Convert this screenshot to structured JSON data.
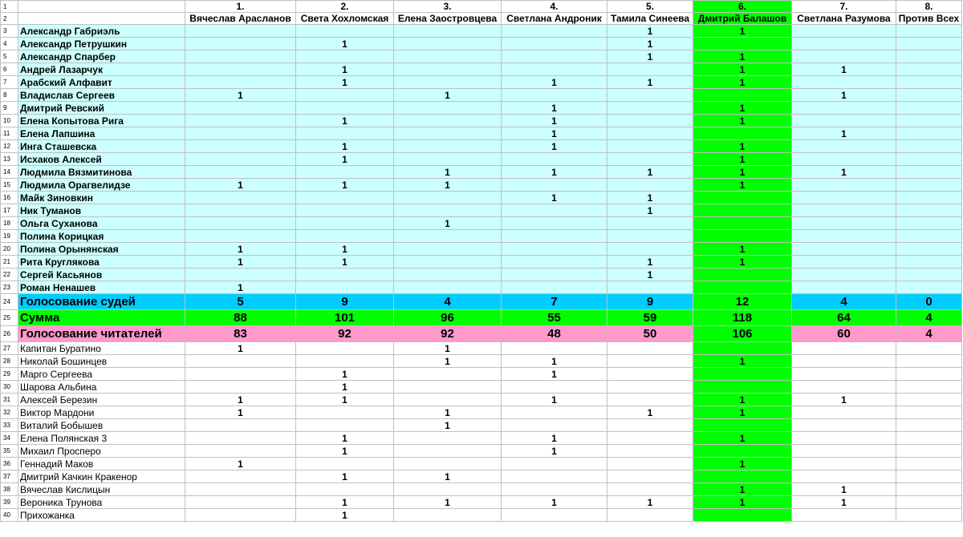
{
  "sheet": {
    "accent_colors": {
      "judge_rows": "#ccffff",
      "highlight_column": "#00ff00",
      "judges_total_row": "#00ccff",
      "sum_row": "#00ff00",
      "readers_total_row": "#ff99cc"
    },
    "header_numbers": [
      "1.",
      "2.",
      "3.",
      "4.",
      "5.",
      "6.",
      "7.",
      "8."
    ],
    "candidates": [
      "Вячеслав Арасланов",
      "Света Хохломская",
      "Елена Заостровцева",
      "Светлана Андроник",
      "Тамила Синеева",
      "Дмитрий Балашов",
      "Светлана Разумова",
      "Против Всех"
    ],
    "judges": [
      {
        "row": "3",
        "name": "Александр Габриэль",
        "votes": [
          "",
          "",
          "",
          "",
          "1",
          "1",
          "",
          ""
        ]
      },
      {
        "row": "4",
        "name": "Александр Петрушкин",
        "votes": [
          "",
          "1",
          "",
          "",
          "1",
          "",
          "",
          ""
        ]
      },
      {
        "row": "5",
        "name": "Александр Спарбер",
        "votes": [
          "",
          "",
          "",
          "",
          "1",
          "1",
          "",
          ""
        ]
      },
      {
        "row": "6",
        "name": "Андрей Лазарчук",
        "votes": [
          "",
          "1",
          "",
          "",
          "",
          "1",
          "1",
          ""
        ]
      },
      {
        "row": "7",
        "name": "Арабский Алфавит",
        "votes": [
          "",
          "1",
          "",
          "1",
          "1",
          "1",
          "",
          ""
        ]
      },
      {
        "row": "8",
        "name": "Владислав Сергеев",
        "votes": [
          "1",
          "",
          "1",
          "",
          "",
          "",
          "1",
          ""
        ]
      },
      {
        "row": "9",
        "name": "Дмитрий Ревский",
        "votes": [
          "",
          "",
          "",
          "1",
          "",
          "1",
          "",
          ""
        ]
      },
      {
        "row": "10",
        "name": "Елена Копытова Рига",
        "votes": [
          "",
          "1",
          "",
          "1",
          "",
          "1",
          "",
          ""
        ]
      },
      {
        "row": "11",
        "name": "Елена Лапшина",
        "votes": [
          "",
          "",
          "",
          "1",
          "",
          "",
          "1",
          ""
        ]
      },
      {
        "row": "12",
        "name": "Инга Сташевска",
        "votes": [
          "",
          "1",
          "",
          "1",
          "",
          "1",
          "",
          ""
        ]
      },
      {
        "row": "13",
        "name": "Исхаков Алексей",
        "votes": [
          "",
          "1",
          "",
          "",
          "",
          "1",
          "",
          ""
        ]
      },
      {
        "row": "14",
        "name": "Людмила Вязмитинова",
        "votes": [
          "",
          "",
          "1",
          "1",
          "1",
          "1",
          "1",
          ""
        ]
      },
      {
        "row": "15",
        "name": "Людмила Орагвелидзе",
        "votes": [
          "1",
          "1",
          "1",
          "",
          "",
          "1",
          "",
          ""
        ]
      },
      {
        "row": "16",
        "name": "Майк Зиновкин",
        "votes": [
          "",
          "",
          "",
          "1",
          "1",
          "",
          "",
          ""
        ]
      },
      {
        "row": "17",
        "name": "Ник Туманов",
        "votes": [
          "",
          "",
          "",
          "",
          "1",
          "",
          "",
          ""
        ]
      },
      {
        "row": "18",
        "name": "Ольга Суханова",
        "votes": [
          "",
          "",
          "1",
          "",
          "",
          "",
          "",
          ""
        ]
      },
      {
        "row": "19",
        "name": "Полина Корицкая",
        "votes": [
          "",
          "",
          "",
          "",
          "",
          "",
          "",
          ""
        ]
      },
      {
        "row": "20",
        "name": "Полина Орынянская",
        "votes": [
          "1",
          "1",
          "",
          "",
          "",
          "1",
          "",
          ""
        ]
      },
      {
        "row": "21",
        "name": "Рита Круглякова",
        "votes": [
          "1",
          "1",
          "",
          "",
          "1",
          "1",
          "",
          ""
        ]
      },
      {
        "row": "22",
        "name": "Сергей Касьянов",
        "votes": [
          "",
          "",
          "",
          "",
          "1",
          "",
          "",
          ""
        ]
      },
      {
        "row": "23",
        "name": "Роман Ненашев",
        "votes": [
          "1",
          "",
          "",
          "",
          "",
          "",
          "",
          ""
        ]
      }
    ],
    "totals": [
      {
        "row": "24",
        "label": "Голосование судей",
        "values": [
          "5",
          "9",
          "4",
          "7",
          "9",
          "12",
          "4",
          "0"
        ]
      },
      {
        "row": "25",
        "label": "Сумма",
        "values": [
          "88",
          "101",
          "96",
          "55",
          "59",
          "118",
          "64",
          "4"
        ]
      },
      {
        "row": "26",
        "label": "Голосование читателей",
        "values": [
          "83",
          "92",
          "92",
          "48",
          "50",
          "106",
          "60",
          "4"
        ]
      }
    ],
    "readers": [
      {
        "row": "27",
        "name": "Капитан Буратино",
        "votes": [
          "1",
          "",
          "1",
          "",
          "",
          "",
          "",
          ""
        ]
      },
      {
        "row": "28",
        "name": "Николай Бошинцев",
        "votes": [
          "",
          "",
          "1",
          "1",
          "",
          "1",
          "",
          ""
        ]
      },
      {
        "row": "29",
        "name": "Марго Сергеева",
        "votes": [
          "",
          "1",
          "",
          "1",
          "",
          "",
          "",
          ""
        ]
      },
      {
        "row": "30",
        "name": "Шарова Альбина",
        "votes": [
          "",
          "1",
          "",
          "",
          "",
          "",
          "",
          ""
        ]
      },
      {
        "row": "31",
        "name": "Алексей Березин",
        "votes": [
          "1",
          "1",
          "",
          "1",
          "",
          "1",
          "1",
          ""
        ]
      },
      {
        "row": "32",
        "name": "Виктор Мардони",
        "votes": [
          "1",
          "",
          "1",
          "",
          "1",
          "1",
          "",
          ""
        ]
      },
      {
        "row": "33",
        "name": "Виталий Бобышев",
        "votes": [
          "",
          "",
          "1",
          "",
          "",
          "",
          "",
          ""
        ]
      },
      {
        "row": "34",
        "name": "Елена Полянская 3",
        "votes": [
          "",
          "1",
          "",
          "1",
          "",
          "1",
          "",
          ""
        ]
      },
      {
        "row": "35",
        "name": "Михаил Просперо",
        "votes": [
          "",
          "1",
          "",
          "1",
          "",
          "",
          "",
          ""
        ]
      },
      {
        "row": "36",
        "name": "Геннадий Маков",
        "votes": [
          "1",
          "",
          "",
          "",
          "",
          "1",
          "",
          ""
        ]
      },
      {
        "row": "37",
        "name": "Дмитрий Качкин Кракенор",
        "votes": [
          "",
          "1",
          "1",
          "",
          "",
          "",
          "",
          ""
        ]
      },
      {
        "row": "38",
        "name": "Вячеслав Кислицын",
        "votes": [
          "",
          "",
          "",
          "",
          "",
          "1",
          "1",
          ""
        ]
      },
      {
        "row": "39",
        "name": "Вероника Трунова",
        "votes": [
          "",
          "1",
          "1",
          "1",
          "1",
          "1",
          "1",
          ""
        ]
      },
      {
        "row": "40",
        "name": "Прихожанка",
        "votes": [
          "",
          "1",
          "",
          "",
          "",
          "",
          "",
          ""
        ]
      }
    ]
  }
}
